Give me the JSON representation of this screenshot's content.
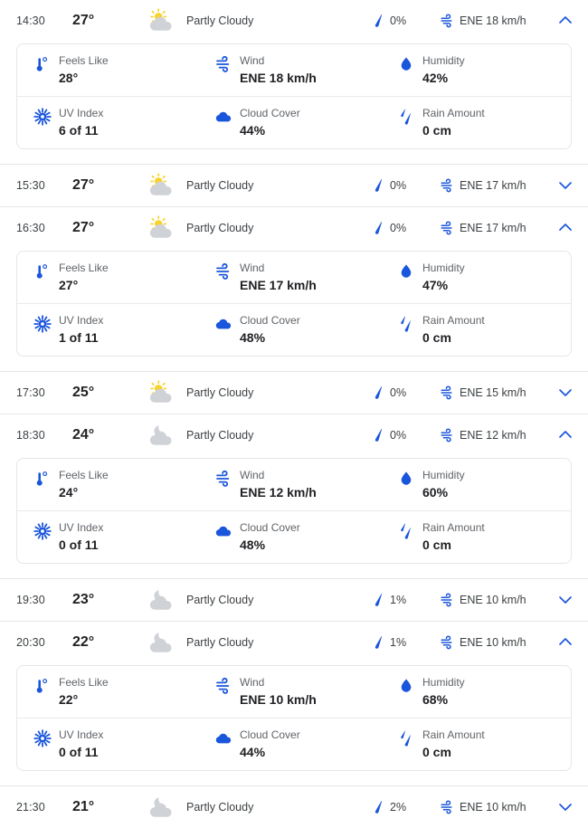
{
  "accent": {
    "blue": "#1a56db",
    "chevron_blue": "#1a56db",
    "cloud_gray": "#cfd2d6",
    "sun_yellow": "#f6d32d",
    "divider": "#e4e6e9"
  },
  "labels": {
    "feels_like": "Feels Like",
    "wind": "Wind",
    "humidity": "Humidity",
    "uv_index": "UV Index",
    "cloud_cover": "Cloud Cover",
    "rain_amount": "Rain Amount"
  },
  "hours": [
    {
      "time": "14:30",
      "temp": "27°",
      "condition": "Partly Cloudy",
      "icon": "partly-cloudy-day-icon",
      "precip": "0%",
      "wind": "ENE 18 km/h",
      "expanded": true,
      "chevron": "chevron-up-icon",
      "details": {
        "feels_like": "28°",
        "wind": "ENE 18 km/h",
        "humidity": "42%",
        "uv_index": "6 of 11",
        "cloud_cover": "44%",
        "rain_amount": "0 cm"
      }
    },
    {
      "time": "15:30",
      "temp": "27°",
      "condition": "Partly Cloudy",
      "icon": "partly-cloudy-day-icon",
      "precip": "0%",
      "wind": "ENE 17 km/h",
      "expanded": false,
      "chevron": "chevron-down-icon",
      "details": null
    },
    {
      "time": "16:30",
      "temp": "27°",
      "condition": "Partly Cloudy",
      "icon": "partly-cloudy-day-icon",
      "precip": "0%",
      "wind": "ENE 17 km/h",
      "expanded": true,
      "chevron": "chevron-up-icon",
      "details": {
        "feels_like": "27°",
        "wind": "ENE 17 km/h",
        "humidity": "47%",
        "uv_index": "1 of 11",
        "cloud_cover": "48%",
        "rain_amount": "0 cm"
      }
    },
    {
      "time": "17:30",
      "temp": "25°",
      "condition": "Partly Cloudy",
      "icon": "partly-cloudy-day-icon",
      "precip": "0%",
      "wind": "ENE 15 km/h",
      "expanded": false,
      "chevron": "chevron-down-icon",
      "details": null
    },
    {
      "time": "18:30",
      "temp": "24°",
      "condition": "Partly Cloudy",
      "icon": "partly-cloudy-night-icon",
      "precip": "0%",
      "wind": "ENE 12 km/h",
      "expanded": true,
      "chevron": "chevron-up-icon",
      "details": {
        "feels_like": "24°",
        "wind": "ENE 12 km/h",
        "humidity": "60%",
        "uv_index": "0 of 11",
        "cloud_cover": "48%",
        "rain_amount": "0 cm"
      }
    },
    {
      "time": "19:30",
      "temp": "23°",
      "condition": "Partly Cloudy",
      "icon": "partly-cloudy-night-icon",
      "precip": "1%",
      "wind": "ENE 10 km/h",
      "expanded": false,
      "chevron": "chevron-down-icon",
      "details": null
    },
    {
      "time": "20:30",
      "temp": "22°",
      "condition": "Partly Cloudy",
      "icon": "partly-cloudy-night-icon",
      "precip": "1%",
      "wind": "ENE 10 km/h",
      "expanded": true,
      "chevron": "chevron-up-icon",
      "details": {
        "feels_like": "22°",
        "wind": "ENE 10 km/h",
        "humidity": "68%",
        "uv_index": "0 of 11",
        "cloud_cover": "44%",
        "rain_amount": "0 cm"
      }
    },
    {
      "time": "21:30",
      "temp": "21°",
      "condition": "Partly Cloudy",
      "icon": "partly-cloudy-night-icon",
      "precip": "2%",
      "wind": "ENE 10 km/h",
      "expanded": false,
      "chevron": "chevron-down-icon",
      "details": null
    }
  ]
}
